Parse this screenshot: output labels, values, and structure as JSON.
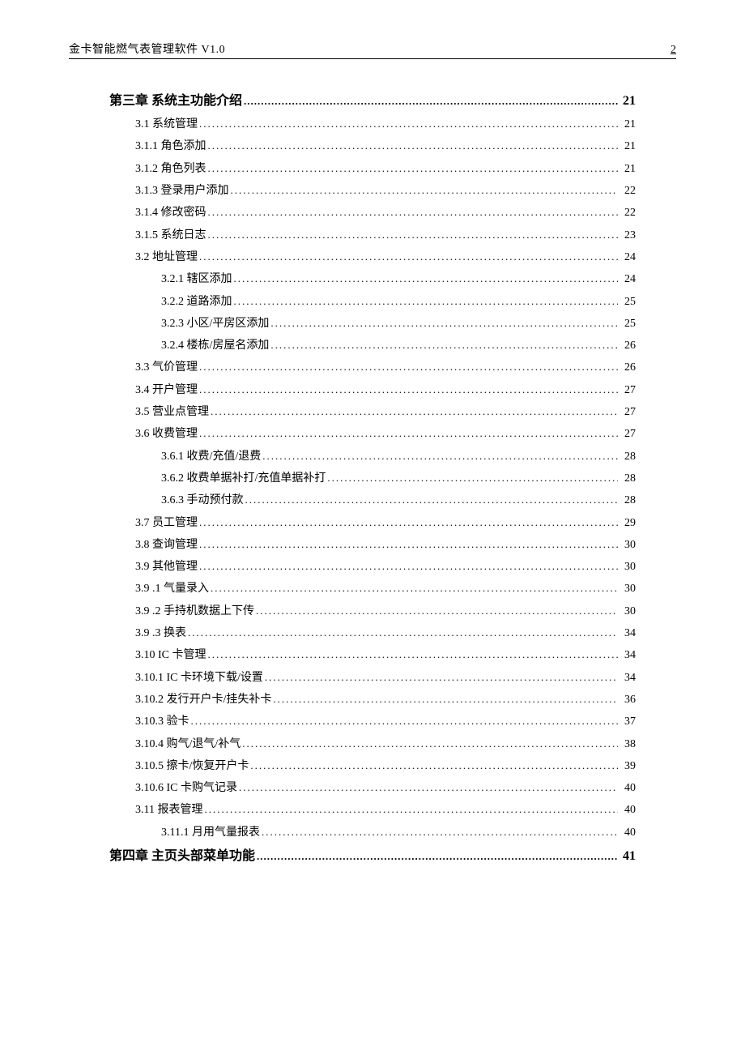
{
  "header": {
    "title": "金卡智能燃气表管理软件 V1.0",
    "page_number": "2"
  },
  "toc": [
    {
      "label": "第三章  系统主功能介绍",
      "page": "21",
      "indent": 0,
      "chapter": true
    },
    {
      "label": "3.1 系统管理 ",
      "page": "21",
      "indent": 1
    },
    {
      "label": "3.1.1   角色添加 ",
      "page": "21",
      "indent": 1
    },
    {
      "label": "3.1.2   角色列表 ",
      "page": "21",
      "indent": 1
    },
    {
      "label": "3.1.3   登录用户添加 ",
      "page": "22",
      "indent": 1
    },
    {
      "label": "3.1.4   修改密码 ",
      "page": "22",
      "indent": 1
    },
    {
      "label": "3.1.5   系统日志 ",
      "page": "23",
      "indent": 1
    },
    {
      "label": "3.2  地址管理 ",
      "page": "24",
      "indent": 1
    },
    {
      "label": "3.2.1 辖区添加",
      "page": "24",
      "indent": 2
    },
    {
      "label": "3.2.2 道路添加",
      "page": "25",
      "indent": 2
    },
    {
      "label": "3.2.3 小区/平房区添加",
      "page": "25",
      "indent": 2
    },
    {
      "label": "3.2.4 楼栋/房屋名添加",
      "page": "26",
      "indent": 2
    },
    {
      "label": "3.3  气价管理 ",
      "page": "26",
      "indent": 1
    },
    {
      "label": "3.4  开户管理 ",
      "page": "27",
      "indent": 1
    },
    {
      "label": "3.5  营业点管理 ",
      "page": "27",
      "indent": 1
    },
    {
      "label": "3.6  收费管理 ",
      "page": "27",
      "indent": 1
    },
    {
      "label": "3.6.1 收费/充值/退费",
      "page": "28",
      "indent": 2
    },
    {
      "label": "3.6.2  收费单据补打/充值单据补打",
      "page": "28",
      "indent": 2
    },
    {
      "label": "3.6.3  手动预付款",
      "page": "28",
      "indent": 2
    },
    {
      "label": "3.7  员工管理 ",
      "page": "29",
      "indent": 1
    },
    {
      "label": "3.8  查询管理 ",
      "page": "30",
      "indent": 1
    },
    {
      "label": "3.9  其他管理 ",
      "page": "30",
      "indent": 1
    },
    {
      "label": "3.9 .1 气量录入 ",
      "page": "30",
      "indent": 1
    },
    {
      "label": "3.9 .2 手持机数据上下传 ",
      "page": "30",
      "indent": 1
    },
    {
      "label": "3.9 .3 换表 ",
      "page": "34",
      "indent": 1
    },
    {
      "label": "3.10  IC 卡管理",
      "page": "34",
      "indent": 1
    },
    {
      "label": "3.10.1  IC 卡环境下载/设置",
      "page": "34",
      "indent": 1
    },
    {
      "label": "3.10.2 发行开户卡/挂失补卡 ",
      "page": "36",
      "indent": 1
    },
    {
      "label": "3.10.3  验卡 ",
      "page": "37",
      "indent": 1
    },
    {
      "label": "3.10.4 购气/退气/补气 ",
      "page": "38",
      "indent": 1
    },
    {
      "label": "3.10.5 擦卡/恢复开户卡 ",
      "page": "39",
      "indent": 1
    },
    {
      "label": "3.10.6  IC 卡购气记录 ",
      "page": "40",
      "indent": 1
    },
    {
      "label": "3.11 报表管理 ",
      "page": "40",
      "indent": 1
    },
    {
      "label": "3.11.1 月用气量报表",
      "page": "40",
      "indent": 2
    },
    {
      "label": "第四章  主页头部菜单功能",
      "page": "41",
      "indent": 0,
      "chapter": true
    }
  ]
}
